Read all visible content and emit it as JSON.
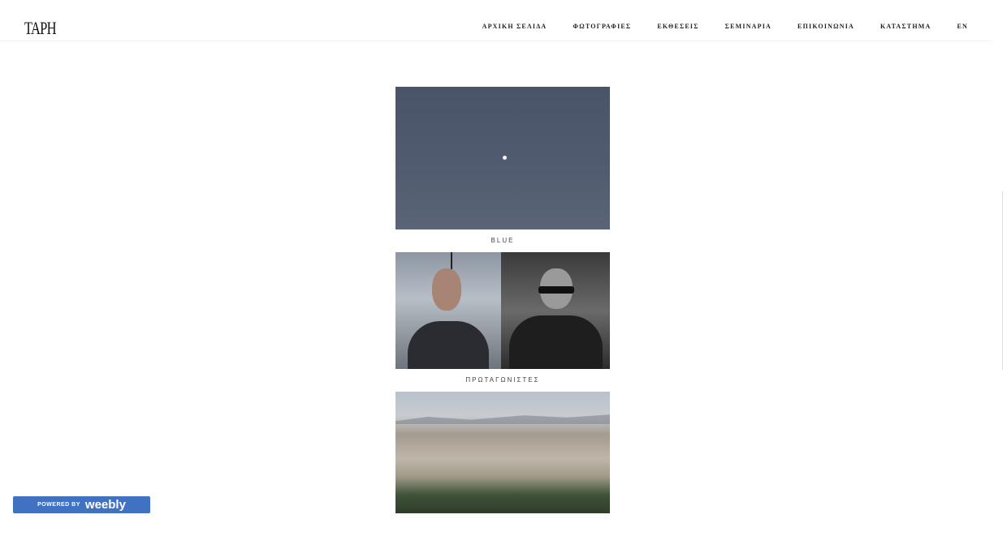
{
  "header": {
    "logo": "TAPH",
    "nav": [
      "ΑΡΧΙΚΗ ΣΕΛΙΔΑ",
      "ΦΩΤΟΓΡΑΦΙΕΣ",
      "ΕΚΘΕΣΕΙΣ",
      "ΣΕΜΙΝΑΡΙΑ",
      "ΕΠΙΚΟΙΝΩΝΙΑ",
      "ΚΑΤΑΣΤΗΜΑ",
      "EN"
    ]
  },
  "gallery": {
    "items": [
      {
        "caption": "BLUE"
      },
      {
        "caption": "ΠΡΩΤΑΓΩΝΙΣΤΕΣ"
      },
      {
        "caption": ""
      }
    ]
  },
  "footer_badge": {
    "powered_by": "POWERED BY",
    "brand": "weebly",
    "color": "#4172c1"
  }
}
